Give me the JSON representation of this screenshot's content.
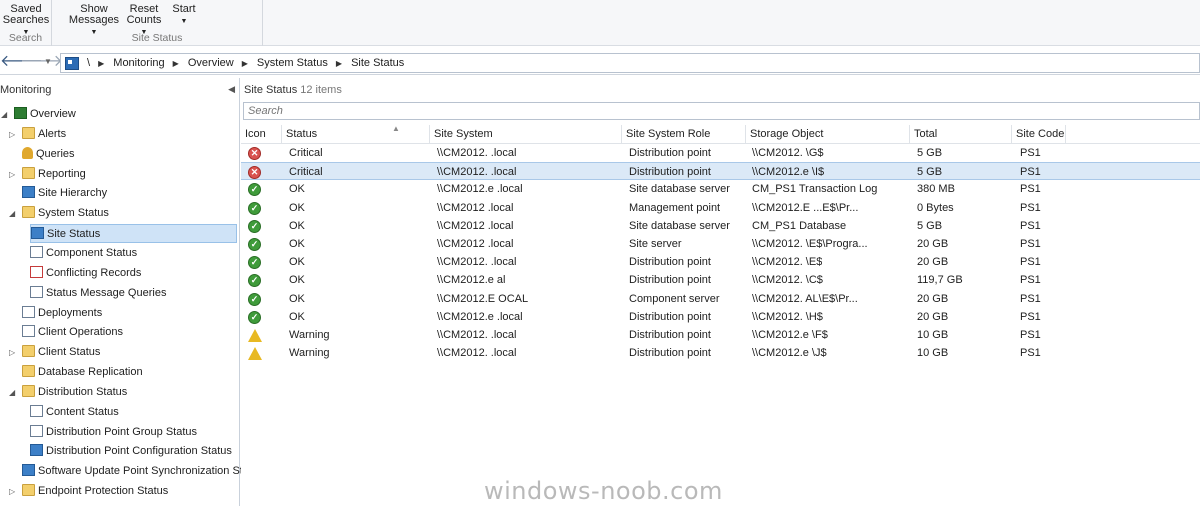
{
  "ribbon": {
    "groups": [
      {
        "label": "Search",
        "buttons": [
          {
            "line1": "Saved",
            "line2": "Searches",
            "dropdown": true
          }
        ]
      },
      {
        "label": "Site Status",
        "buttons": [
          {
            "line1": "Show",
            "line2": "Messages",
            "dropdown": true
          },
          {
            "line1": "Reset",
            "line2": "Counts",
            "dropdown": true
          },
          {
            "line1": "Start",
            "line2": "",
            "dropdown": true
          }
        ]
      }
    ]
  },
  "addressbar": {
    "back_icon": "back-arrow-icon",
    "forward_icon": "forward-arrow-icon",
    "breadcrumbs": [
      "\\",
      "Monitoring",
      "Overview",
      "System Status",
      "Site Status"
    ]
  },
  "leftnav": {
    "title": "Monitoring",
    "items": [
      {
        "label": "Overview",
        "level": 0,
        "expanded": true,
        "icon": "overview-icon"
      },
      {
        "label": "Alerts",
        "level": 1,
        "expandable": true,
        "icon": "folder-icon"
      },
      {
        "label": "Queries",
        "level": 1,
        "icon": "queries-icon"
      },
      {
        "label": "Reporting",
        "level": 1,
        "expandable": true,
        "icon": "folder-icon"
      },
      {
        "label": "Site Hierarchy",
        "level": 1,
        "icon": "site-hierarchy-icon"
      },
      {
        "label": "System Status",
        "level": 1,
        "expanded": true,
        "icon": "folder-icon"
      },
      {
        "label": "Site Status",
        "level": 2,
        "selected": true,
        "icon": "site-status-icon"
      },
      {
        "label": "Component Status",
        "level": 2,
        "icon": "component-status-icon"
      },
      {
        "label": "Conflicting Records",
        "level": 2,
        "icon": "conflicting-records-icon"
      },
      {
        "label": "Status Message Queries",
        "level": 2,
        "icon": "status-message-icon"
      },
      {
        "label": "Deployments",
        "level": 1,
        "icon": "deployments-icon"
      },
      {
        "label": "Client Operations",
        "level": 1,
        "icon": "client-operations-icon"
      },
      {
        "label": "Client Status",
        "level": 1,
        "expandable": true,
        "icon": "folder-icon"
      },
      {
        "label": "Database Replication",
        "level": 1,
        "icon": "database-replication-icon"
      },
      {
        "label": "Distribution Status",
        "level": 1,
        "expanded": true,
        "icon": "folder-icon"
      },
      {
        "label": "Content Status",
        "level": 2,
        "icon": "content-status-icon"
      },
      {
        "label": "Distribution Point Group Status",
        "level": 2,
        "icon": "dp-group-status-icon"
      },
      {
        "label": "Distribution Point Configuration Status",
        "level": 2,
        "icon": "dp-config-status-icon"
      },
      {
        "label": "Software Update Point Synchronization Status",
        "level": 1,
        "icon": "sup-sync-icon"
      },
      {
        "label": "Endpoint Protection Status",
        "level": 1,
        "expandable": true,
        "icon": "folder-icon"
      }
    ]
  },
  "main": {
    "title": "Site Status",
    "count": "12 items",
    "search_placeholder": "Search",
    "columns": [
      "Icon",
      "Status",
      "Site System",
      "Site System Role",
      "Storage Object",
      "Total",
      "Site Code"
    ],
    "rows": [
      {
        "icon": "critical",
        "status": "Critical",
        "site_system": "\\\\CM2012.            .local",
        "role": "Distribution point",
        "storage": "\\\\CM2012.             \\G$",
        "total": "5 GB",
        "code": "PS1"
      },
      {
        "icon": "critical",
        "status": "Critical",
        "site_system": "\\\\CM2012.            .local",
        "role": "Distribution point",
        "storage": "\\\\CM2012.e             \\I$",
        "total": "5 GB",
        "code": "PS1",
        "selected": true
      },
      {
        "icon": "ok",
        "status": "OK",
        "site_system": "\\\\CM2012.e           .local",
        "role": "Site database server",
        "storage": "CM_PS1 Transaction Log",
        "total": "380 MB",
        "code": "PS1"
      },
      {
        "icon": "ok",
        "status": "OK",
        "site_system": "\\\\CM2012              .local",
        "role": "Management point",
        "storage": "\\\\CM2012.E           ...E$\\Pr...",
        "total": "0 Bytes",
        "code": "PS1"
      },
      {
        "icon": "ok",
        "status": "OK",
        "site_system": "\\\\CM2012              .local",
        "role": "Site database server",
        "storage": "CM_PS1 Database",
        "total": "5 GB",
        "code": "PS1"
      },
      {
        "icon": "ok",
        "status": "OK",
        "site_system": "\\\\CM2012              .local",
        "role": "Site server",
        "storage": "\\\\CM2012.          \\E$\\Progra...",
        "total": "20 GB",
        "code": "PS1"
      },
      {
        "icon": "ok",
        "status": "OK",
        "site_system": "\\\\CM2012.            .local",
        "role": "Distribution point",
        "storage": "\\\\CM2012.            \\E$",
        "total": "20 GB",
        "code": "PS1"
      },
      {
        "icon": "ok",
        "status": "OK",
        "site_system": "\\\\CM2012.e            al",
        "role": "Distribution point",
        "storage": "\\\\CM2012.           \\C$",
        "total": "119,7 GB",
        "code": "PS1"
      },
      {
        "icon": "ok",
        "status": "OK",
        "site_system": "\\\\CM2012.E           OCAL",
        "role": "Component server",
        "storage": "\\\\CM2012.          AL\\E$\\Pr...",
        "total": "20 GB",
        "code": "PS1"
      },
      {
        "icon": "ok",
        "status": "OK",
        "site_system": "\\\\CM2012.e           .local",
        "role": "Distribution point",
        "storage": "\\\\CM2012.            \\H$",
        "total": "20 GB",
        "code": "PS1"
      },
      {
        "icon": "warning",
        "status": "Warning",
        "site_system": "\\\\CM2012.            .local",
        "role": "Distribution point",
        "storage": "\\\\CM2012.e            \\F$",
        "total": "10 GB",
        "code": "PS1"
      },
      {
        "icon": "warning",
        "status": "Warning",
        "site_system": "\\\\CM2012.            .local",
        "role": "Distribution point",
        "storage": "\\\\CM2012.e            \\J$",
        "total": "10 GB",
        "code": "PS1"
      }
    ]
  },
  "watermark": "windows-noob.com"
}
